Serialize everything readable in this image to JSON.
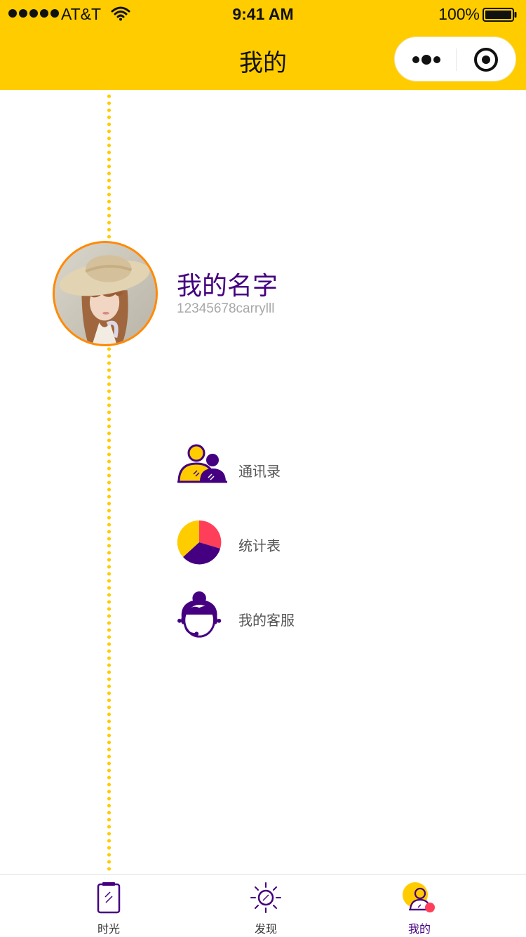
{
  "status_bar": {
    "carrier": "AT&T",
    "time": "9:41 AM",
    "battery": "100%"
  },
  "nav": {
    "title": "我的"
  },
  "profile": {
    "name": "我的名字",
    "id": "12345678carrylll"
  },
  "menu": [
    {
      "label": "通讯录",
      "icon": "contacts-icon"
    },
    {
      "label": "统计表",
      "icon": "pie-chart-icon"
    },
    {
      "label": "我的客服",
      "icon": "customer-service-icon"
    }
  ],
  "tabs": [
    {
      "label": "时光",
      "icon": "notebook-icon",
      "active": false
    },
    {
      "label": "发现",
      "icon": "sun-compass-icon",
      "active": false
    },
    {
      "label": "我的",
      "icon": "user-icon",
      "active": true
    }
  ],
  "colors": {
    "brand_yellow": "#ffcc00",
    "accent_purple": "#440080",
    "accent_red": "#ff3f5a"
  }
}
